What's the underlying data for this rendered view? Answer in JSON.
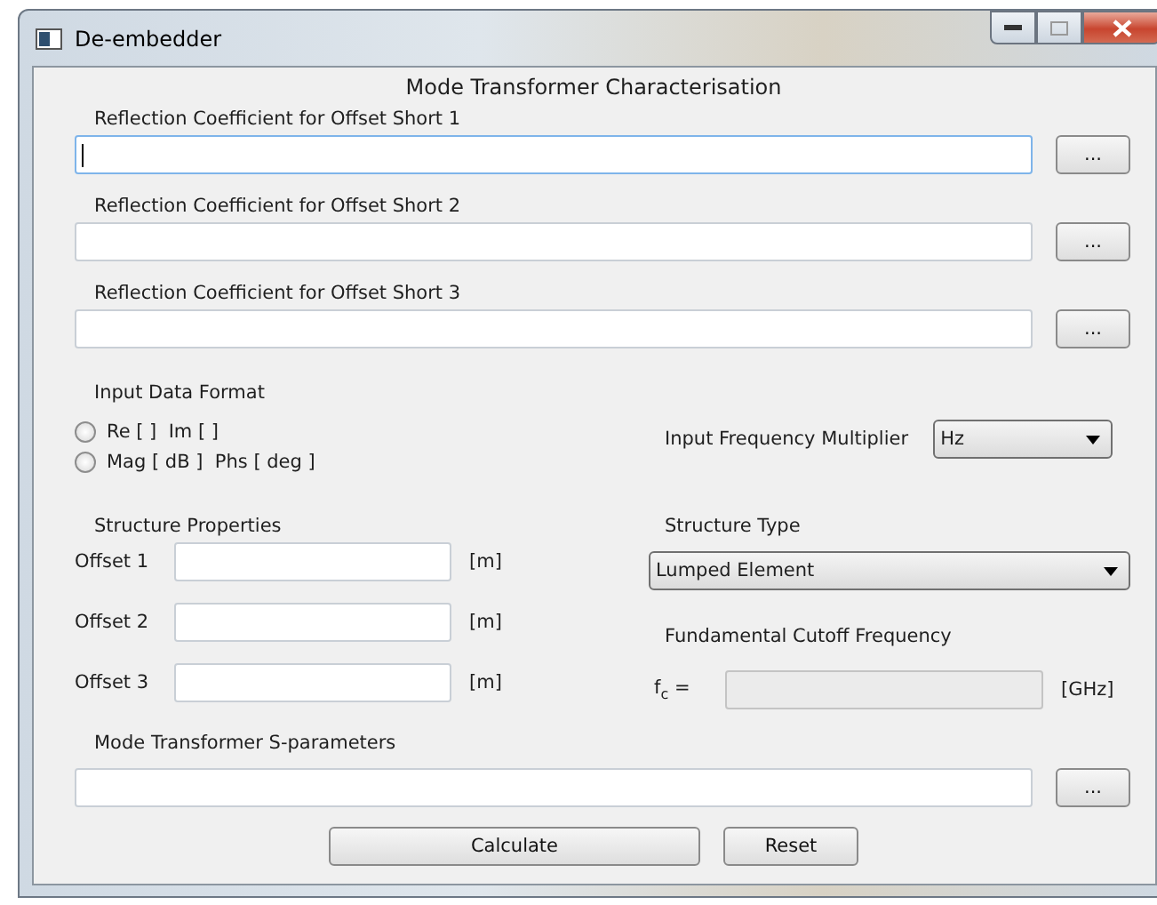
{
  "window": {
    "title": "De-embedder"
  },
  "heading": "Mode Transformer Characterisation",
  "file_inputs": [
    {
      "label": "Reflection Coefficient for Offset Short 1",
      "focused": true,
      "button": "..."
    },
    {
      "label": "Reflection Coefficient for Offset Short 2",
      "focused": false,
      "button": "..."
    },
    {
      "label": "Reflection Coefficient for Offset Short 3",
      "focused": false,
      "button": "..."
    }
  ],
  "input_data_format": {
    "label": "Input Data Format",
    "options": [
      {
        "label": "Re [ ]  Im [ ]",
        "selected": false
      },
      {
        "label": "Mag [ dB ]  Phs [ deg ]",
        "selected": false
      }
    ]
  },
  "frequency_multiplier": {
    "label": "Input Frequency Multiplier",
    "value": "Hz"
  },
  "structure_properties": {
    "label": "Structure Properties",
    "offsets": [
      {
        "label": "Offset 1",
        "unit": "[m]"
      },
      {
        "label": "Offset 2",
        "unit": "[m]"
      },
      {
        "label": "Offset 3",
        "unit": "[m]"
      }
    ]
  },
  "structure_type": {
    "label": "Structure Type",
    "value": "Lumped Element"
  },
  "cutoff": {
    "label": "Fundamental Cutoff Frequency",
    "symbol": "f$_{c}$ =",
    "unit": "[GHz]",
    "disabled": true
  },
  "sparams": {
    "label": "Mode Transformer S-parameters",
    "button": "..."
  },
  "buttons": [
    "Calculate",
    "Reset"
  ]
}
